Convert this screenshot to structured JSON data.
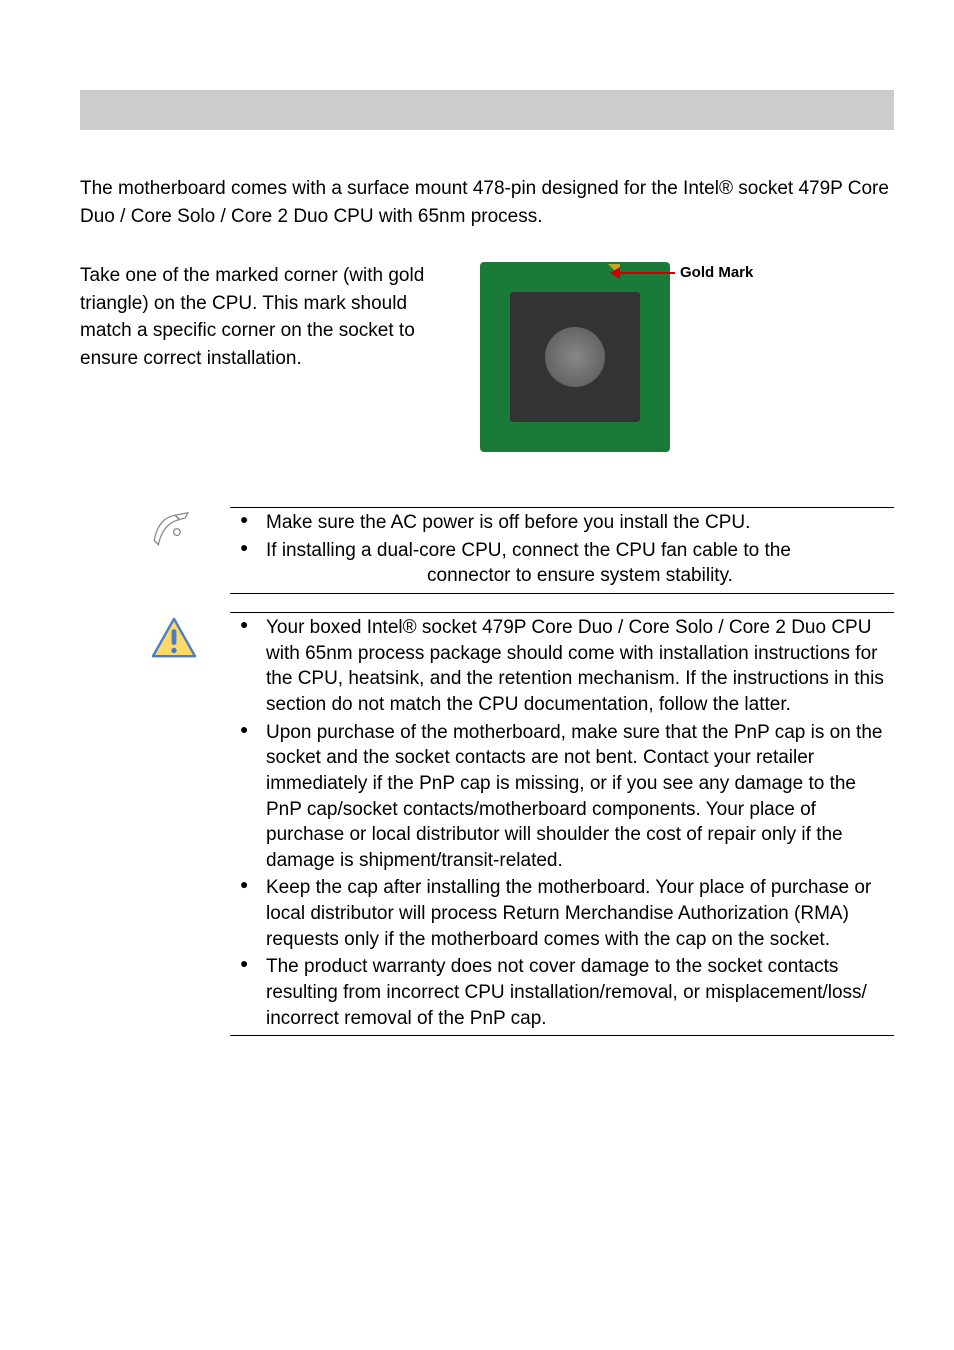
{
  "intro": "The motherboard comes with a surface mount 478-pin designed for the Intel® socket 479P Core Duo / Core Solo / Core 2 Duo CPU with 65nm process.",
  "corner_instruction": "Take one of the marked corner (with gold triangle) on the CPU. This mark should match a specific corner on the socket to ensure correct installation.",
  "gold_mark_label": "Gold Mark",
  "note_block": {
    "items": [
      "Make sure the AC power is off before you install the CPU.",
      "If installing a dual-core CPU, connect the CPU fan cable to the"
    ],
    "continuation": "connector to ensure system stability."
  },
  "warning_block": {
    "items": [
      "Your boxed Intel® socket 479P Core Duo / Core Solo / Core 2 Duo CPU with 65nm process package should come with installation instructions for the CPU, heatsink, and the retention mechanism. If the instructions in this section do not match the CPU documentation, follow the latter.",
      "Upon purchase of the motherboard, make sure that the PnP cap is on the socket and the socket contacts are not bent. Contact your retailer immediately if the PnP cap is missing, or if you see any damage to the PnP cap/socket contacts/motherboard components. Your place of purchase or local distributor will shoulder the cost of repair only if the damage is shipment/transit-related.",
      "Keep the cap after installing the motherboard. Your place of purchase or local distributor will process Return Merchandise Authorization (RMA) requests only if the motherboard comes with the cap on the socket.",
      "The product warranty does not cover damage to the socket contacts resulting from incorrect CPU installation/removal, or misplacement/loss/ incorrect removal of the PnP cap."
    ]
  }
}
